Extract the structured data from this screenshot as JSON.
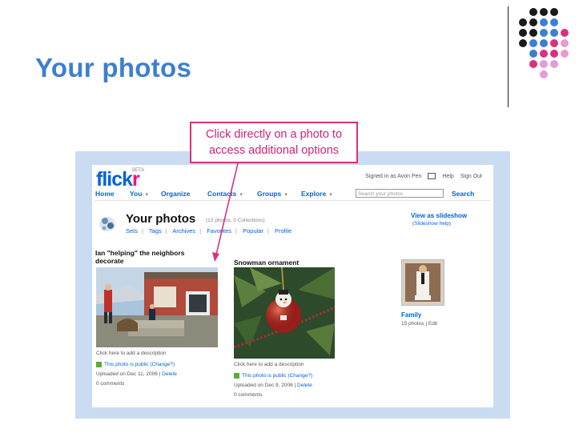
{
  "slide": {
    "title": "Your photos",
    "callout": "Click directly on a photo to access additional options",
    "dot_colors": [
      "#1a1a1a",
      "#3d7fd0",
      "#d9307f",
      "#e99ad3"
    ]
  },
  "flickr": {
    "logo_text": "flick",
    "logo_r": "r",
    "beta": "BETA",
    "topbar": {
      "signed_in": "Signed in as Avon Pen",
      "mail_icon": "mail-icon",
      "help": "Help",
      "sign_out": "Sign Out"
    },
    "nav": [
      {
        "label": "Home",
        "dropdown": false
      },
      {
        "label": "You",
        "dropdown": true
      },
      {
        "label": "Organize",
        "dropdown": false
      },
      {
        "label": "Contacts",
        "dropdown": true
      },
      {
        "label": "Groups",
        "dropdown": true
      },
      {
        "label": "Explore",
        "dropdown": true
      }
    ],
    "search_placeholder": "Search your photos",
    "search_button": "Search",
    "page_heading": "Your photos",
    "photo_count": "(13 photos, 0 Collections)",
    "subnav": [
      "Sets",
      "Tags",
      "Archives",
      "Favorites",
      "Popular",
      "Profile"
    ],
    "slideshow": "View as slideshow",
    "slideshow_sub": "(Slideshow help)",
    "photos": [
      {
        "title": "Ian \"helping\" the neighbors decorate",
        "description": "Click here to add a description",
        "privacy": "This photo is public (Change?)",
        "uploaded": "Uploaded on Dec 11, 2006",
        "delete": "Delete",
        "comments": "0 comments"
      },
      {
        "title": "Snowman ornament",
        "description": "Click here to add a description",
        "privacy": "This photo is public (Change?)",
        "uploaded": "Uploaded on Dec 9, 2006",
        "delete": "Delete",
        "comments": "0 comments"
      }
    ],
    "set": {
      "title": "Family",
      "meta": "15 photos | Edit"
    }
  }
}
